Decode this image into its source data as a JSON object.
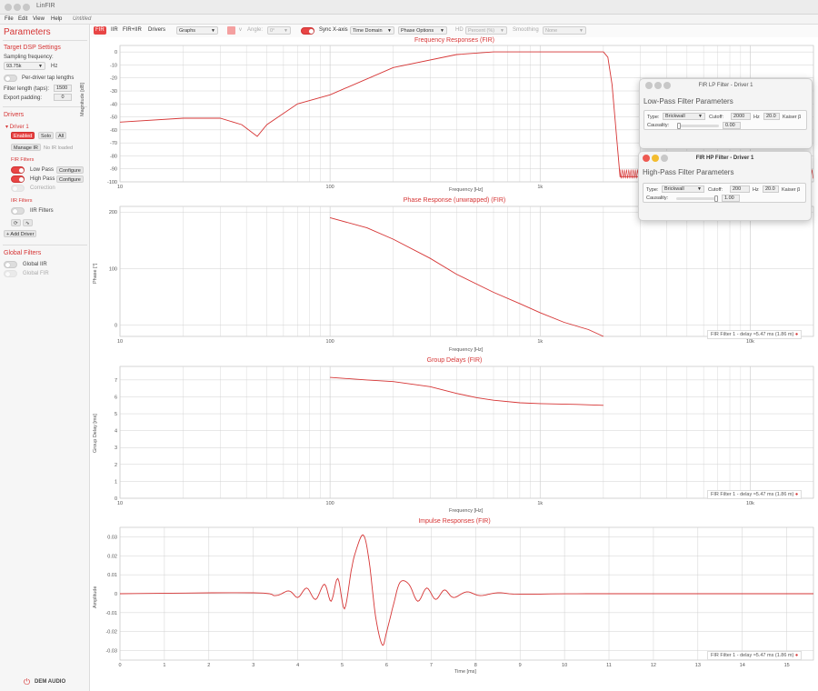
{
  "window": {
    "title": "LinFIR",
    "doc": "Untitled"
  },
  "menu": [
    "File",
    "Edit",
    "View",
    "Help"
  ],
  "sidebar": {
    "heading": "Parameters",
    "dsp_heading": "Target DSP Settings",
    "sampling_label": "Sampling frequency:",
    "sampling_value": "93.75k",
    "sampling_unit": "Hz",
    "per_driver_label": "Per-driver tap lengths",
    "filter_length_label": "Filter length (taps):",
    "filter_length_value": "1500",
    "export_padding_label": "Export padding:",
    "export_padding_value": "0",
    "drivers_heading": "Drivers",
    "driver_name": "▾ Driver 1",
    "enabled_label": "Enabled",
    "solo_label": "Solo",
    "all_label": "All",
    "manage_ir_label": "Manage IR",
    "no_ir_label": "No IR loaded",
    "fir_heading": "FIR Filters",
    "low_pass_label": "Low Pass",
    "high_pass_label": "High Pass",
    "configure_label": "Configure",
    "correction_label": "Correction",
    "iir_heading": "IIR Filters",
    "iir_filters_label": "IIR Filters",
    "icon_a": "⟳",
    "icon_b": "∿",
    "add_driver_label": "+ Add Driver",
    "global_heading": "Global Filters",
    "global_iir_label": "Global IIR",
    "global_fir_label": "Global FIR",
    "brand": "DEM AUDIO"
  },
  "toolbar": {
    "fir": "FIR",
    "iir": "IIR",
    "fir_iir": "FIR+IIR",
    "drivers": "Drivers",
    "graphs": "Graphs",
    "v_label": "v",
    "angle_label": "Angle:",
    "angle_value": "0°",
    "sync_label": "Sync X-axis",
    "time_domain": "Time Domain",
    "phase_options": "Phase Options",
    "hd_label": "HD",
    "percent": "Percent (%)",
    "smoothing_label": "Smoothing",
    "smoothing_value": "None"
  },
  "charts": {
    "freq_title": "Frequency Responses (FIR)",
    "freq_xlabel": "Frequency [Hz]",
    "freq_ylabel": "Magnitude [dB]",
    "phase_title": "Phase Response (unwrapped) (FIR)",
    "phase_xlabel": "Frequency [Hz]",
    "phase_ylabel": "Phase [°]",
    "gd_title": "Group Delays (FIR)",
    "gd_xlabel": "Frequency [Hz]",
    "gd_ylabel": "Group Delay [ms]",
    "imp_title": "Impulse Responses (FIR)",
    "imp_xlabel": "Time [ms]",
    "imp_ylabel": "Amplitude",
    "legend": "FIR Filter 1 - delay ≈5.47 ms (1.86 m)"
  },
  "chart_data": [
    {
      "type": "line",
      "title": "Frequency Responses (FIR)",
      "xlabel": "Frequency [Hz]",
      "ylabel": "Magnitude [dB]",
      "xscale": "log",
      "xlim": [
        10,
        20000
      ],
      "ylim": [
        -100,
        5
      ],
      "xticks": [
        10,
        100,
        "1k",
        "10k"
      ],
      "yticks": [
        0,
        -10,
        -20,
        -30,
        -40,
        -50,
        -60,
        -70,
        -80,
        -90,
        -100
      ],
      "series": [
        {
          "x": [
            10,
            20,
            30,
            38,
            45,
            50,
            70,
            100,
            200,
            400,
            600,
            800,
            1200,
            1700,
            2000,
            2100,
            2200,
            2400,
            3000,
            6000,
            10000
          ],
          "y": [
            -54,
            -51,
            -51,
            -56,
            -65,
            -56,
            -40,
            -33,
            -12,
            -2,
            0,
            0,
            0,
            0,
            0,
            -4,
            -25,
            -96,
            -96,
            -96,
            -96
          ]
        }
      ]
    },
    {
      "type": "line",
      "title": "Phase Response (unwrapped) (FIR)",
      "xlabel": "Frequency [Hz]",
      "ylabel": "Phase [°]",
      "xscale": "log",
      "xlim": [
        10,
        20000
      ],
      "ylim": [
        -20,
        210
      ],
      "yticks": [
        0,
        100,
        200
      ],
      "legend": "FIR Filter 1 - delay ≈5.47 ms (1.86 m)",
      "series": [
        {
          "x": [
            100,
            150,
            200,
            300,
            400,
            600,
            800,
            1000,
            1300,
            1700,
            2000
          ],
          "y": [
            190,
            172,
            152,
            118,
            90,
            58,
            38,
            22,
            5,
            -8,
            -20
          ]
        }
      ]
    },
    {
      "type": "line",
      "title": "Group Delays (FIR)",
      "xlabel": "Frequency [Hz]",
      "ylabel": "Group Delay [ms]",
      "xscale": "log",
      "xlim": [
        10,
        20000
      ],
      "ylim": [
        0,
        7.8
      ],
      "yticks": [
        0,
        1,
        2,
        3,
        4,
        5,
        6,
        7
      ],
      "legend": "FIR Filter 1 - delay ≈5.47 ms (1.86 m)",
      "series": [
        {
          "x": [
            100,
            150,
            200,
            300,
            400,
            500,
            600,
            800,
            1000,
            1500,
            2000
          ],
          "y": [
            7.15,
            7.0,
            6.9,
            6.6,
            6.2,
            5.95,
            5.8,
            5.65,
            5.6,
            5.55,
            5.5
          ]
        }
      ]
    },
    {
      "type": "line",
      "title": "Impulse Responses (FIR)",
      "xlabel": "Time [ms]",
      "ylabel": "Amplitude",
      "xlim": [
        0,
        15.6
      ],
      "ylim": [
        -0.035,
        0.035
      ],
      "xticks": [
        0,
        1,
        2,
        3,
        4,
        5,
        6,
        7,
        8,
        9,
        10,
        11,
        12,
        13,
        14,
        15
      ],
      "yticks": [
        0.03,
        0.02,
        0.01,
        0,
        -0.01,
        -0.02,
        -0.03
      ],
      "legend": "FIR Filter 1 - delay ≈5.47 ms (1.86 m)",
      "series": [
        {
          "t": [
            0,
            3.0,
            3.5,
            3.8,
            4.0,
            4.2,
            4.4,
            4.6,
            4.75,
            4.9,
            5.05,
            5.2,
            5.3,
            5.47,
            5.6,
            5.75,
            5.9,
            6.0,
            6.15,
            6.3,
            6.5,
            6.7,
            6.9,
            7.1,
            7.3,
            7.5,
            7.8,
            8.1,
            8.5,
            9.0,
            10.5,
            15.6
          ],
          "v": [
            0,
            0.0005,
            -0.001,
            0.0015,
            -0.002,
            0.003,
            -0.003,
            0.005,
            -0.004,
            0.008,
            -0.008,
            0.012,
            0.022,
            0.031,
            0.018,
            -0.012,
            -0.027,
            -0.02,
            -0.006,
            0.006,
            0.005,
            -0.004,
            0.003,
            -0.003,
            0.002,
            -0.002,
            0.001,
            -0.001,
            0.0005,
            -0.0003,
            0,
            0
          ]
        }
      ]
    }
  ],
  "lp_dialog": {
    "title": "FIR LP Filter - Driver 1",
    "heading": "Low-Pass Filter Parameters",
    "type_label": "Type:",
    "type_value": "Brickwall",
    "cutoff_label": "Cutoff:",
    "cutoff_value": "2000",
    "hz": "Hz",
    "q_value": "20.0",
    "kaiser_label": "Kaiser β",
    "causality_label": "Causality:",
    "causality_value": "0.00",
    "causality_fraction": 0.0
  },
  "hp_dialog": {
    "title": "FIR HP Filter - Driver 1",
    "heading": "High-Pass Filter Parameters",
    "type_label": "Type:",
    "type_value": "Brickwall",
    "cutoff_label": "Cutoff:",
    "cutoff_value": "200",
    "hz": "Hz",
    "q_value": "20.0",
    "kaiser_label": "Kaiser β",
    "causality_label": "Causality:",
    "causality_value": "1.00",
    "causality_fraction": 1.0
  },
  "colors": {
    "accent": "#d63535",
    "grid": "#d0d0d0",
    "curve": "#d63535"
  }
}
